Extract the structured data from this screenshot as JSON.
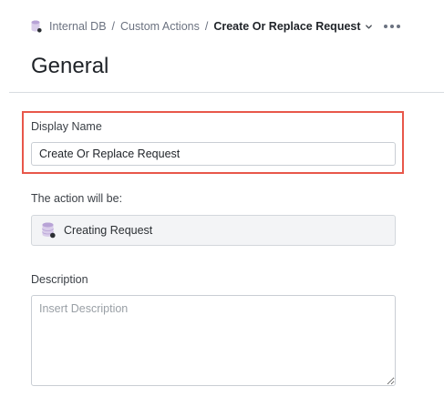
{
  "breadcrumb": {
    "root_icon": "database-icon",
    "items": [
      "Internal DB",
      "Custom Actions"
    ],
    "current": "Create Or Replace Request",
    "separator": "/",
    "dropdown_icon": "chevron-down-icon",
    "more_icon": "more-horizontal-icon"
  },
  "page": {
    "title": "General"
  },
  "form": {
    "display_name": {
      "label": "Display Name",
      "value": "Create Or Replace Request",
      "highlight_color": "#e8574a"
    },
    "action": {
      "label": "The action will be:",
      "icon": "database-icon",
      "value": "Creating Request"
    },
    "description": {
      "label": "Description",
      "placeholder": "Insert Description",
      "value": ""
    }
  }
}
